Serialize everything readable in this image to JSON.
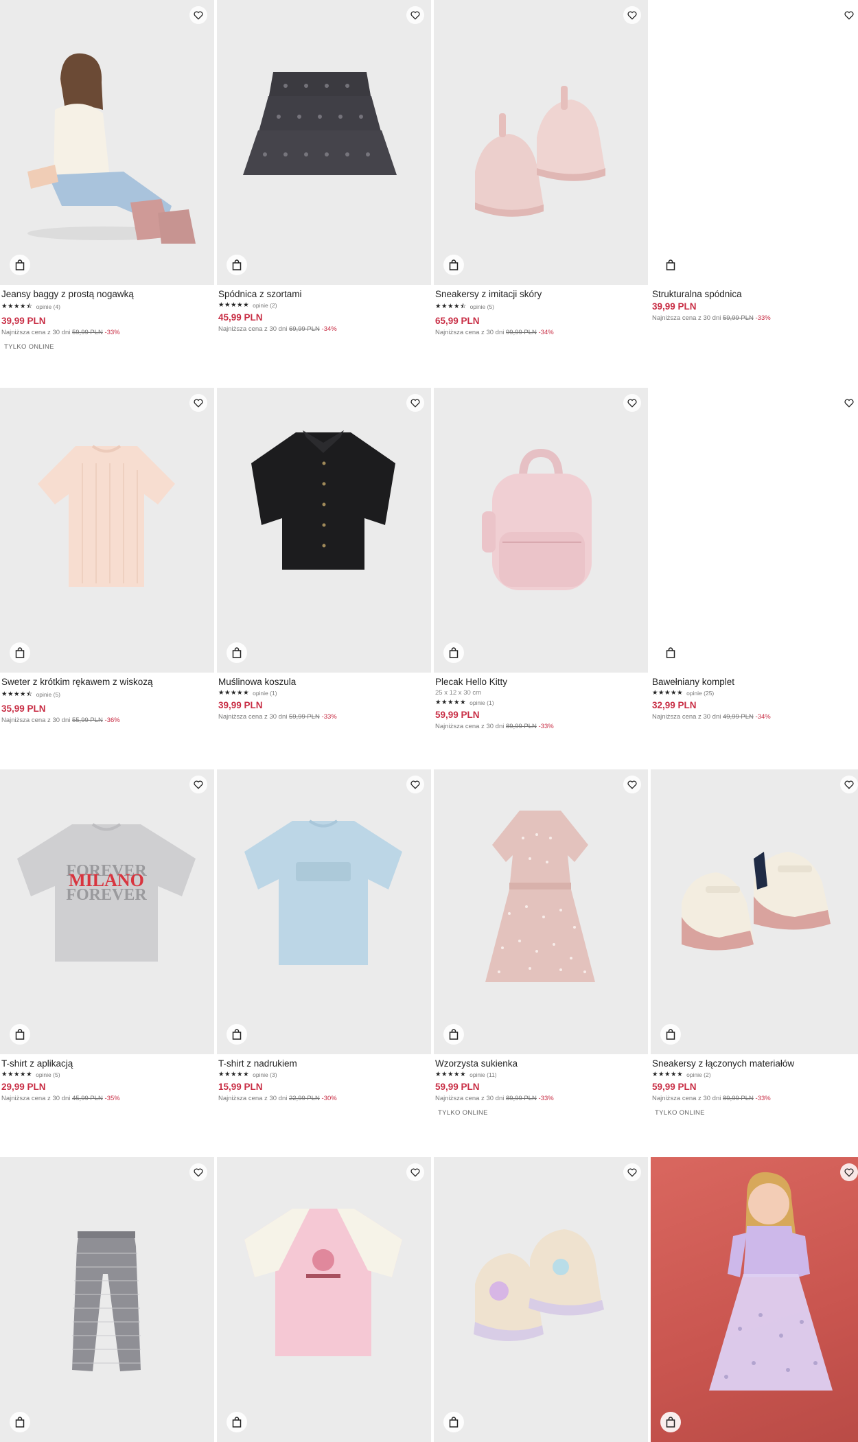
{
  "products": [
    {
      "name": "Jeansy baggy z prostą nogawką",
      "stars": "★★★★⯪",
      "reviews": "opinie (4)",
      "price": "39,99 PLN",
      "lowest_label": "Najniższa cena z 30 dni",
      "old_price": "59,99 PLN",
      "discount": "-33%",
      "badge": "TYLKO ONLINE"
    },
    {
      "name": "Spódnica z szortami",
      "stars": "★★★★★",
      "reviews": "opinie (2)",
      "price": "45,99 PLN",
      "lowest_label": "Najniższa cena z 30 dni",
      "old_price": "69,99 PLN",
      "discount": "-34%"
    },
    {
      "name": "Sneakersy z imitacji skóry",
      "stars": "★★★★⯪",
      "reviews": "opinie (5)",
      "price": "65,99 PLN",
      "lowest_label": "Najniższa cena z 30 dni",
      "old_price": "99,99 PLN",
      "discount": "-34%"
    },
    {
      "name": "Strukturalna spódnica",
      "price": "39,99 PLN",
      "lowest_label": "Najniższa cena z 30 dni",
      "old_price": "59,99 PLN",
      "discount": "-33%"
    },
    {
      "name": "Sweter z krótkim rękawem z wiskozą",
      "stars": "★★★★⯪",
      "reviews": "opinie (5)",
      "price": "35,99 PLN",
      "lowest_label": "Najniższa cena z 30 dni",
      "old_price": "55,99 PLN",
      "discount": "-36%"
    },
    {
      "name": "Muślinowa koszula",
      "stars": "★★★★★",
      "reviews": "opinie (1)",
      "price": "39,99 PLN",
      "lowest_label": "Najniższa cena z 30 dni",
      "old_price": "59,99 PLN",
      "discount": "-33%"
    },
    {
      "name": "Plecak Hello Kitty",
      "dims": "25 x 12 x 30 cm",
      "stars": "★★★★★",
      "reviews": "opinie (1)",
      "price": "59,99 PLN",
      "lowest_label": "Najniższa cena z 30 dni",
      "old_price": "89,99 PLN",
      "discount": "-33%"
    },
    {
      "name": "Bawełniany komplet",
      "stars": "★★★★★",
      "reviews": "opinie (25)",
      "price": "32,99 PLN",
      "lowest_label": "Najniższa cena z 30 dni",
      "old_price": "49,99 PLN",
      "discount": "-34%"
    },
    {
      "name": "T-shirt z aplikacją",
      "stars": "★★★★★",
      "reviews": "opinie (5)",
      "price": "29,99 PLN",
      "lowest_label": "Najniższa cena z 30 dni",
      "old_price": "45,99 PLN",
      "discount": "-35%",
      "print_text": "MILANO"
    },
    {
      "name": "T-shirt z nadrukiem",
      "stars": "★★★★★",
      "reviews": "opinie (3)",
      "price": "15,99 PLN",
      "lowest_label": "Najniższa cena z 30 dni",
      "old_price": "22,99 PLN",
      "discount": "-30%"
    },
    {
      "name": "Wzorzysta sukienka",
      "stars": "★★★★★",
      "reviews": "opinie (11)",
      "price": "59,99 PLN",
      "lowest_label": "Najniższa cena z 30 dni",
      "old_price": "89,99 PLN",
      "discount": "-33%",
      "badge": "TYLKO ONLINE"
    },
    {
      "name": "Sneakersy z łączonych materiałów",
      "stars": "★★★★★",
      "reviews": "opinie (2)",
      "price": "59,99 PLN",
      "lowest_label": "Najniższa cena z 30 dni",
      "old_price": "89,99 PLN",
      "discount": "-33%",
      "badge": "TYLKO ONLINE"
    },
    {},
    {},
    {},
    {}
  ],
  "icons": {
    "wishlist": "heart-icon",
    "cart": "shopping-bag-icon"
  },
  "colors": {
    "price": "#c82d44",
    "image_bg": "#ebebeb",
    "text": "#222222"
  }
}
